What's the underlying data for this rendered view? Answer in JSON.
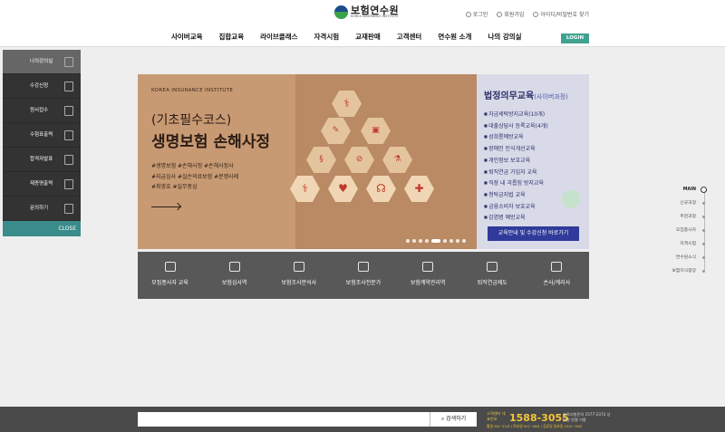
{
  "header": {
    "logo_text": "보험연수원",
    "logo_sub": "KOREA INSURANCE INSTITUTE",
    "util": [
      "로그인",
      "회원가입",
      "아이디/비밀번호 찾기"
    ]
  },
  "gnb": {
    "items": [
      "사이버교육",
      "집합교육",
      "라이브클래스",
      "자격시험",
      "교재판매",
      "고객센터",
      "연수원 소개",
      "나의 강의실"
    ],
    "login_label": "LOGIN"
  },
  "quick_menu": {
    "items": [
      "나의강의실",
      "수강신청",
      "원서접수",
      "수험표출력",
      "합격자발표",
      "제증명출력",
      "문의하기"
    ],
    "close_label": "CLOSE"
  },
  "banner": {
    "kicker": "KOREA INSURANCE INSTITUTE",
    "title_line1": "(기초필수코스)",
    "title_line2": "생명보험 손해사정",
    "tags": [
      "#생명보험 #손해사정 #손해사정사",
      "#지급심사 #실손의료보험 #분쟁사례",
      "#최영호 #실무중심"
    ],
    "slide_count": 9,
    "active_slide": 5
  },
  "side_panel": {
    "title": "법정의무교육",
    "title_sub": "(사이버과정)",
    "items": [
      "자금세탁방지교육(10개)",
      "대출상담사 등록교육(4개)",
      "성희롱예방교육",
      "장애인 인식개선교육",
      "개인정보 보호교육",
      "퇴직연금 가입자 교육",
      "직장 내 괴롭힘 방지교육",
      "청탁금지법 교육",
      "금융소비자 보호교육",
      "감염병 예방교육"
    ],
    "cta_label": "교육안내 및 수강신청 바로가기"
  },
  "courses": [
    "모집종사자 교육",
    "보험심사역",
    "보험조사분석사",
    "보험조사전문가",
    "보험계약관리역",
    "퇴직연금제도",
    "손사/계리사"
  ],
  "right_nav": [
    "MAIN",
    "신규과정",
    "추천과정",
    "모집종사자",
    "자격시험",
    "연수원소식",
    "보험지식광장"
  ],
  "bottom": {
    "search_placeholder": "",
    "search_button": "검색하기",
    "cs_label": "고객센터 대표번호",
    "cs_number": "1588-3055",
    "cs_hours": "평일 9시~21시 / 토요일 9시~16시 / 공휴일 일요일 10시~16시",
    "cs_note": "자격시험문의 1577-2373 상담원 연결 이용"
  }
}
